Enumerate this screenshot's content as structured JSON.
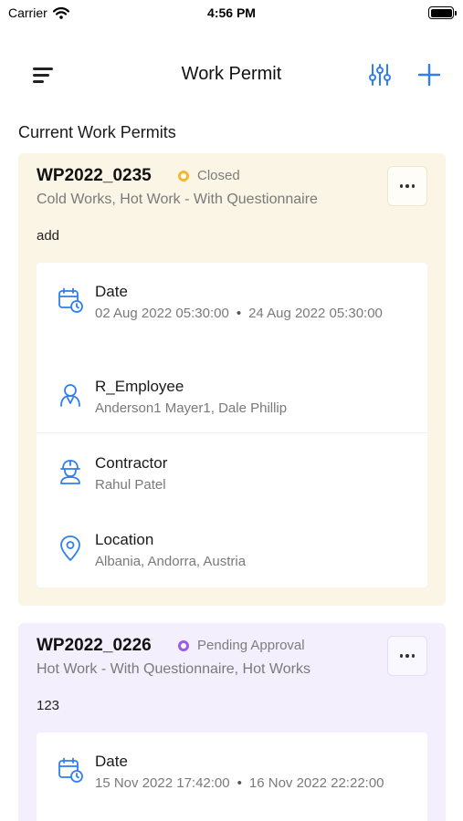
{
  "status_bar": {
    "carrier": "Carrier",
    "time": "4:56 PM"
  },
  "nav": {
    "title": "Work Permit",
    "menu_icon": "menu-icon",
    "filter_icon": "sliders-icon",
    "add_icon": "plus-icon",
    "accent": "#2f7ff0"
  },
  "section_title": "Current Work Permits",
  "permits": [
    {
      "id": "WP2022_0235",
      "status": "Closed",
      "status_color": "#f2b92f",
      "types": "Cold Works, Hot Work - With Questionnaire",
      "description": "add",
      "date_label": "Date",
      "date_start": "02 Aug 2022 05:30:00",
      "date_separator": "•",
      "date_end": "24 Aug 2022 05:30:00",
      "employee_label": "R_Employee",
      "employee_value": "Anderson1 Mayer1, Dale Phillip",
      "contractor_label": "Contractor",
      "contractor_value": "Rahul Patel",
      "location_label": "Location",
      "location_value": "Albania, Andorra, Austria"
    },
    {
      "id": "WP2022_0226",
      "status": "Pending Approval",
      "status_color": "#9b5de5",
      "types": "Hot Work - With Questionnaire, Hot Works",
      "description": "123",
      "date_label": "Date",
      "date_start": "15 Nov 2022 17:42:00",
      "date_separator": "•",
      "date_end": "16 Nov 2022 22:22:00"
    }
  ]
}
